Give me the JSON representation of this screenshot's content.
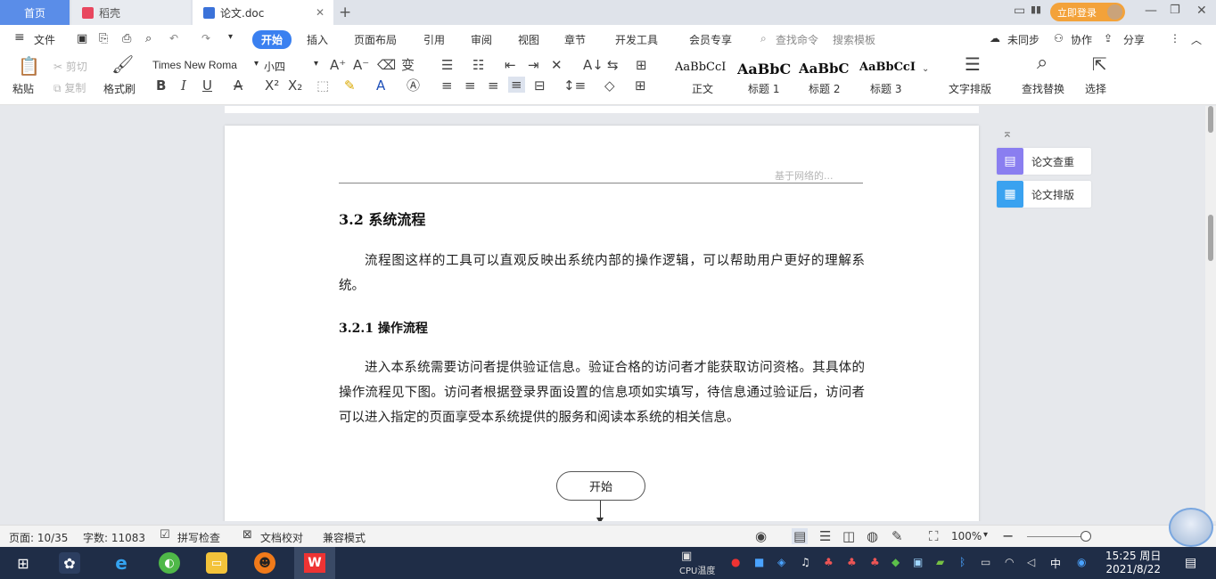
{
  "tabs": {
    "home": "首页",
    "second": "稻壳",
    "doc": "论文.doc",
    "new_tab": "+"
  },
  "title_bar": {
    "login": "立即登录"
  },
  "menu": {
    "file": "文件",
    "items": [
      "开始",
      "插入",
      "页面布局",
      "引用",
      "审阅",
      "视图",
      "章节",
      "开发工具",
      "会员专享"
    ],
    "search_cmd": "查找命令",
    "search_template": "搜索模板",
    "sync": "未同步",
    "collab": "协作",
    "share": "分享"
  },
  "ribbon": {
    "paste": "粘贴",
    "cut": "剪切",
    "copy": "复制",
    "format_painter": "格式刷",
    "font_name": "Times New Roma",
    "font_size": "小四",
    "styles": [
      {
        "sample": "AaBbCcI",
        "label": "正文"
      },
      {
        "sample": "AaBbC",
        "label": "标题 1"
      },
      {
        "sample": "AaBbC",
        "label": "标题 2"
      },
      {
        "sample": "AaBbCcI",
        "label": "标题 3"
      }
    ],
    "text_layout": "文字排版",
    "find_replace": "查找替换",
    "select": "选择"
  },
  "document": {
    "header_text": "基于网络的...",
    "section_title": "3.2  系统流程",
    "para1": "流程图这样的工具可以直观反映出系统内部的操作逻辑，可以帮助用户更好的理解系统。",
    "subsection_title": "3.2.1  操作流程",
    "para2": "进入本系统需要访问者提供验证信息。验证合格的访问者才能获取访问资格。其具体的操作流程见下图。访问者根据登录界面设置的信息项如实填写，待信息通过验证后，访问者可以进入指定的页面享受本系统提供的服务和阅读本系统的相关信息。",
    "flow_start": "开始"
  },
  "side_panel": {
    "check": "论文查重",
    "layout": "论文排版"
  },
  "statusbar": {
    "page": "页面: 10/35",
    "words": "字数: 11083",
    "spell": "拼写检查",
    "proof": "文档校对",
    "compat": "兼容模式",
    "zoom": "100%"
  },
  "taskbar": {
    "cpu_label": "CPU温度",
    "ime": "中",
    "time": "15:25 周日",
    "date": "2021/8/22"
  },
  "colors": {
    "accent": "#3a80f0",
    "home_tab": "#5a8de8",
    "login": "#f3a23a",
    "taskbar": "#1f2d47"
  }
}
